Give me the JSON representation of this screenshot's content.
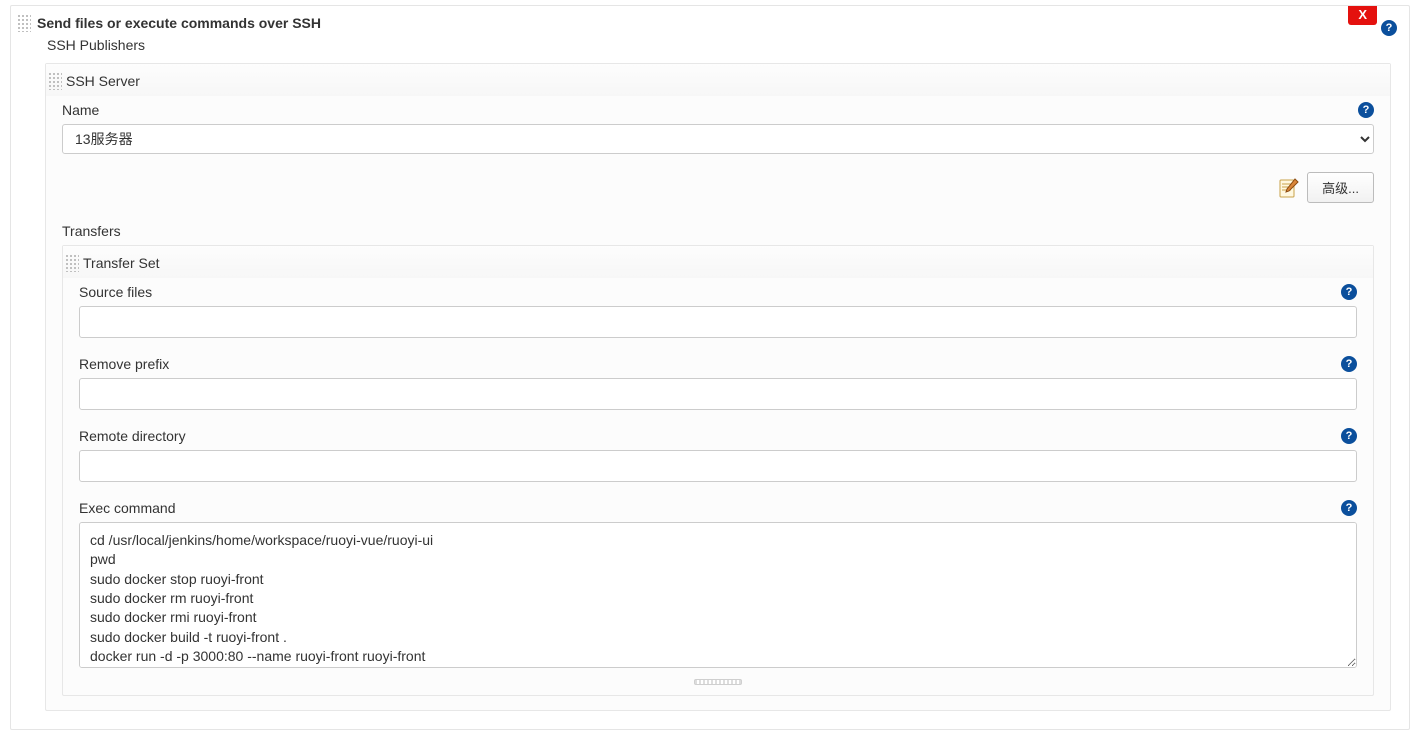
{
  "panel": {
    "title": "Send files or execute commands over SSH",
    "delete_label": "X",
    "subtitle": "SSH Publishers"
  },
  "ssh_server": {
    "legend": "SSH Server",
    "name_label": "Name",
    "name_value": "13服务器",
    "advanced_button": "高级..."
  },
  "transfers": {
    "section_label": "Transfers",
    "transfer_set_legend": "Transfer Set",
    "source_files_label": "Source files",
    "source_files_value": "",
    "remove_prefix_label": "Remove prefix",
    "remove_prefix_value": "",
    "remote_directory_label": "Remote directory",
    "remote_directory_value": "",
    "exec_command_label": "Exec command",
    "exec_command_value": "cd /usr/local/jenkins/home/workspace/ruoyi-vue/ruoyi-ui\npwd\nsudo docker stop ruoyi-front\nsudo docker rm ruoyi-front\nsudo docker rmi ruoyi-front\nsudo docker build -t ruoyi-front .\ndocker run -d -p 3000:80 --name ruoyi-front ruoyi-front"
  },
  "help_glyph": "?"
}
